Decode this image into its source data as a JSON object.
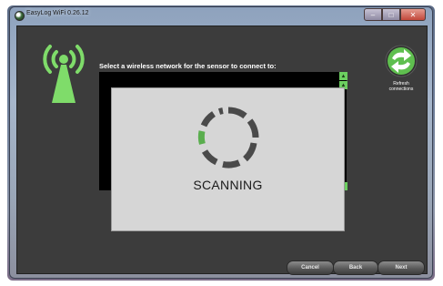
{
  "window": {
    "title": "EasyLog WiFi 0.26.12",
    "buttons": {
      "minimize": "–",
      "maximize": "□",
      "close": "✕"
    }
  },
  "main": {
    "prompt": "Select a wireless network for the sensor to connect to:",
    "refresh_label_line1": "Refresh",
    "refresh_label_line2": "connections",
    "scanning_text": "SCANNING"
  },
  "footer": {
    "cancel_label": "Cancel",
    "back_label": "Back",
    "next_label": "Next"
  },
  "colors": {
    "accent_green": "#6ccf60",
    "panel_dark": "#3c3c3c",
    "overlay_gray": "#d6d6d6"
  },
  "icons": {
    "antenna": "wifi-antenna-icon",
    "refresh": "refresh-icon",
    "spinner": "loading-spinner-icon",
    "scroll_up": "arrow-up-icon",
    "scroll_down": "arrow-down-icon"
  }
}
